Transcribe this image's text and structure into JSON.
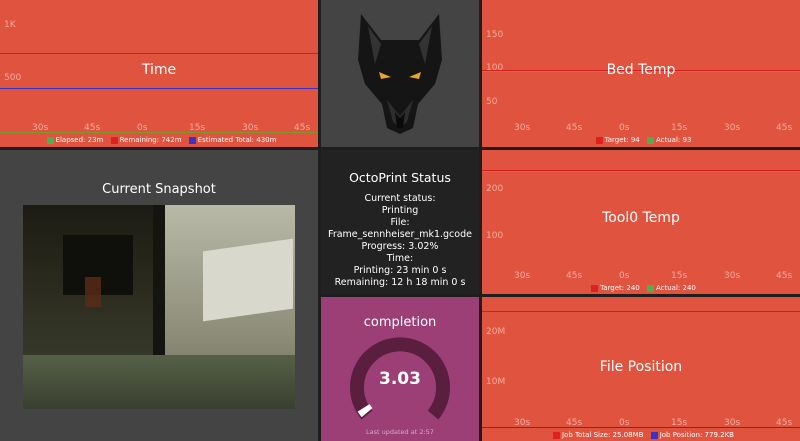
{
  "panels": {
    "time": {
      "title": "Time",
      "y_ticks": [
        "1K",
        "500"
      ],
      "x_ticks": [
        "30s",
        "45s",
        "0s",
        "15s",
        "30s",
        "45s"
      ],
      "legend": [
        {
          "label": "Elapsed: 23m",
          "color": "#4caf50"
        },
        {
          "label": "Remaining: 742m",
          "color": "#e02020"
        },
        {
          "label": "Estimated Total: 430m",
          "color": "#3a33c8"
        }
      ]
    },
    "bed_temp": {
      "title": "Bed Temp",
      "y_ticks": [
        "150",
        "100",
        "50"
      ],
      "x_ticks": [
        "30s",
        "45s",
        "0s",
        "15s",
        "30s",
        "45s"
      ],
      "legend": [
        {
          "label": "Target: 94",
          "color": "#e02020"
        },
        {
          "label": "Actual: 93",
          "color": "#4caf50"
        }
      ]
    },
    "tool0_temp": {
      "title": "Tool0 Temp",
      "y_ticks": [
        "200",
        "100"
      ],
      "x_ticks": [
        "30s",
        "45s",
        "0s",
        "15s",
        "30s",
        "45s"
      ],
      "legend": [
        {
          "label": "Target: 240",
          "color": "#e02020"
        },
        {
          "label": "Actual: 240",
          "color": "#4caf50"
        }
      ]
    },
    "file_position": {
      "title": "File Position",
      "y_ticks": [
        "20M",
        "10M"
      ],
      "x_ticks": [
        "30s",
        "45s",
        "0s",
        "15s",
        "30s",
        "45s"
      ],
      "legend": [
        {
          "label": "Job Total Size: 25.08MB",
          "color": "#e02020"
        },
        {
          "label": "Job Position: 779.2KB",
          "color": "#3a33c8"
        }
      ]
    },
    "snapshot": {
      "title": "Current Snapshot"
    },
    "status": {
      "title": "OctoPrint Status",
      "lines": [
        "Current status:",
        "Printing",
        "File: Frame_sennheiser_mk1.gcode",
        "Progress: 3.02%",
        "Time:",
        "Printing: 23 min 0 s",
        "Remaining: 12 h 18 min 0 s"
      ]
    },
    "completion": {
      "title": "completion",
      "value": "3.03",
      "fraction": 0.0303,
      "footer": "Last updated at 2:57",
      "colors": {
        "track": "#5a1f3e",
        "fill": "#ffffff",
        "background": "#9c3f77"
      }
    }
  },
  "colors": {
    "panel_red": "#e0533f",
    "panel_dark": "#444444",
    "panel_black": "#222222"
  }
}
